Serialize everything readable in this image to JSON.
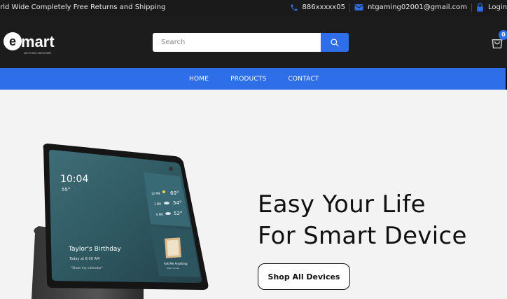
{
  "topbar": {
    "tagline": "orld Wide Completely Free Returns and Shipping",
    "phone": "886xxxxx05",
    "email": "ntgaming02001@gmail.com",
    "login": "Login"
  },
  "header": {
    "logo_text": "emart",
    "logo_tagline": "ANYTHING ANYWHERE",
    "search_placeholder": "Search",
    "cart_count": "0"
  },
  "nav": {
    "items": [
      "HOME",
      "PRODUCTS",
      "CONTACT"
    ]
  },
  "hero": {
    "headline_line1": "Easy Your Life",
    "headline_line2": "For Smart Device",
    "cta_label": "Shop All Devices",
    "device_screen": {
      "time": "10:04",
      "temp": "55°",
      "event_title": "Taylor's Birthday",
      "event_time": "Today at 8:00 AM",
      "event_hint": "\"Show my calendar\"",
      "forecast": [
        {
          "label": "12 PM",
          "temp": "60°"
        },
        {
          "label": "3 PM",
          "temp": "54°"
        },
        {
          "label": "6 PM",
          "temp": "52°"
        }
      ],
      "card_title": "Ask Me Anything",
      "card_sub": "Wall Frames"
    }
  },
  "colors": {
    "accent": "#2e6fe9",
    "dark": "#1c1c1c",
    "hero_bg": "#f3f3f3"
  }
}
